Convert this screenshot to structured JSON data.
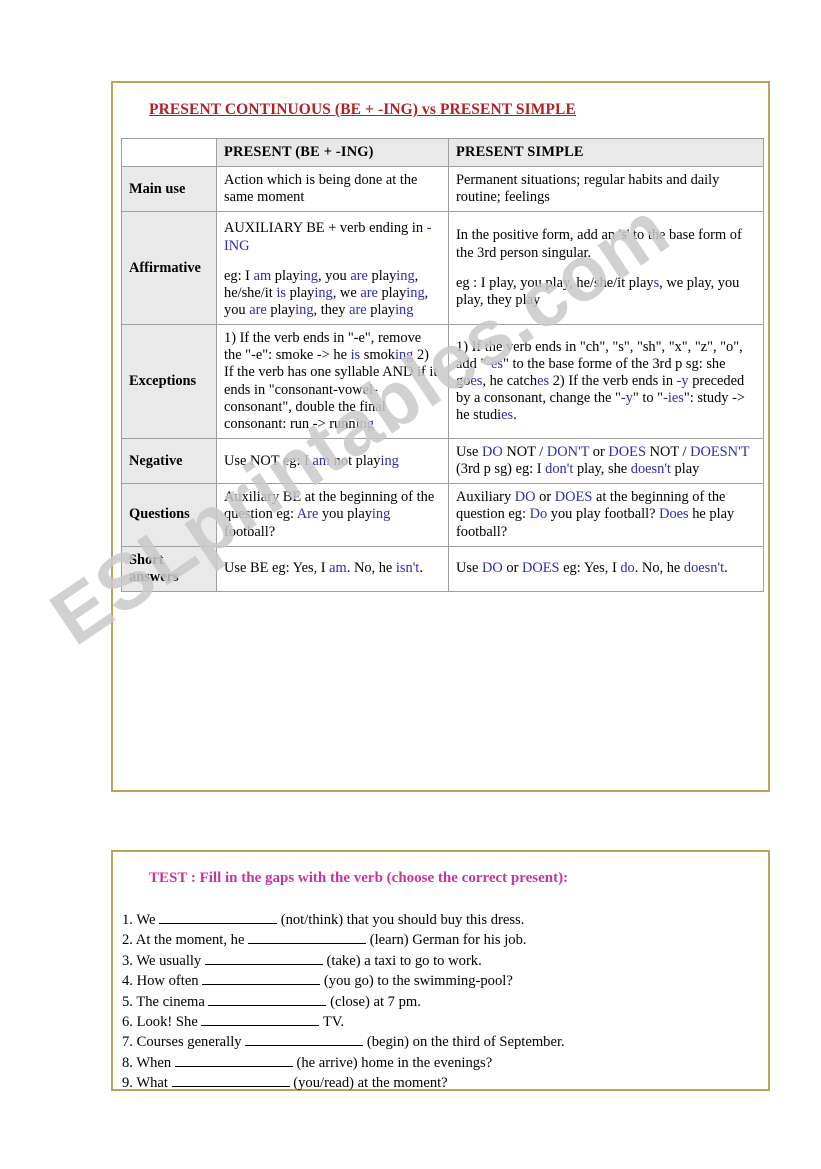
{
  "colors": {
    "frame": "#bda15e",
    "title_red": "#b51f24",
    "label_red": "#cc2229",
    "highlight_blue": "#2b2bb5",
    "test_pink": "#cc3399",
    "header_bg": "#e9e9e9",
    "grid": "#9f9f9f"
  },
  "watermark": {
    "text": "ESLprintables.com"
  },
  "grammar": {
    "title": "PRESENT CONTINUOUS (BE + -ING) vs PRESENT SIMPLE",
    "headers": {
      "blank": "",
      "continuous": "PRESENT (BE + -ING)",
      "simple": "PRESENT SIMPLE"
    },
    "rows": [
      {
        "label": "Main use",
        "continuous": "Action which is being done at the same moment",
        "simple": "Permanent situations; regular habits and daily routine; feelings"
      },
      {
        "label": "Affirmative",
        "continuous_line1": "AUXILIARY BE + verb ending in -ING",
        "continuous_line2": "eg: I am playing, you are playing, he/she/it is playing, we are playing, you are playing, they are playing",
        "simple_line1": "In the positive form, add an 's' to the base form of the 3rd person singular.",
        "simple_line2": "eg : I play, you play, he/she/it plays, we play, you play, they play"
      },
      {
        "label": "Exceptions",
        "continuous_rule1": "1) If the verb ends in \"-e\", remove the \"-e\": smoke -> he is smoking",
        "continuous_rule2": "2) If the verb has one syllable AND if it ends in \"consonant-vowel-consonant\", double the final consonant: run -> running",
        "simple_rule1": "1) If the verb ends in \"ch\", \"s\", \"sh\", \"x\", \"z\", \"o\", add \"-es\" to the base forme of the 3rd p sg: she goes, he catches",
        "simple_rule2": "2) If the verb ends in -y preceded by a consonant, change the \"-y\" to \"-ies\": study -> he studies."
      },
      {
        "label": "Negative",
        "continuous_line1": "Use NOT",
        "continuous_line2": "eg: I am not playing",
        "simple_line1": "Use DO NOT / DON'T or DOES NOT / DOESN'T (3rd p sg)",
        "simple_line2": "eg: I don't play, she doesn't play"
      },
      {
        "label": "Questions",
        "continuous_line1": "Auxiliary BE at the beginning of the question",
        "continuous_line2": "eg: Are you playing football?",
        "simple_line1": "Auxiliary DO or DOES at the beginning of the question",
        "simple_line2": "eg: Do you play football? Does he play football?"
      },
      {
        "label": "Short answers",
        "continuous_line1": "Use BE",
        "continuous_line2": "eg: Yes, I am. No, he isn't.",
        "simple_line1": "Use DO or DOES",
        "simple_line2": "eg: Yes, I do. No, he doesn't."
      }
    ]
  },
  "test": {
    "heading": "TEST : Fill in the gaps with the verb (choose the correct present):",
    "questions": [
      {
        "number": "1.",
        "before": "We",
        "gap_width": 118,
        "after": "(not/think) that you should buy this dress."
      },
      {
        "number": "2.",
        "before": "At the moment, he",
        "gap_width": 118,
        "after": "(learn) German for his job."
      },
      {
        "number": "3.",
        "before": "We usually",
        "gap_width": 118,
        "after": "(take) a taxi to go to work."
      },
      {
        "number": "4.",
        "before": "How often",
        "gap_width": 118,
        "after": "(you go) to the swimming-pool?"
      },
      {
        "number": "5.",
        "before": "The cinema",
        "gap_width": 118,
        "after": "(close) at 7 pm."
      },
      {
        "number": "6.",
        "before": "Look! She",
        "gap_width": 118,
        "after": "TV."
      },
      {
        "number": "7.",
        "before": "Courses generally",
        "gap_width": 118,
        "after": "(begin) on the third of September."
      },
      {
        "number": "8.",
        "before": "When",
        "gap_width": 118,
        "after": "(he arrive) home in the evenings?"
      },
      {
        "number": "9.",
        "before": "What",
        "gap_width": 118,
        "after": "(you/read) at the moment?"
      }
    ]
  }
}
